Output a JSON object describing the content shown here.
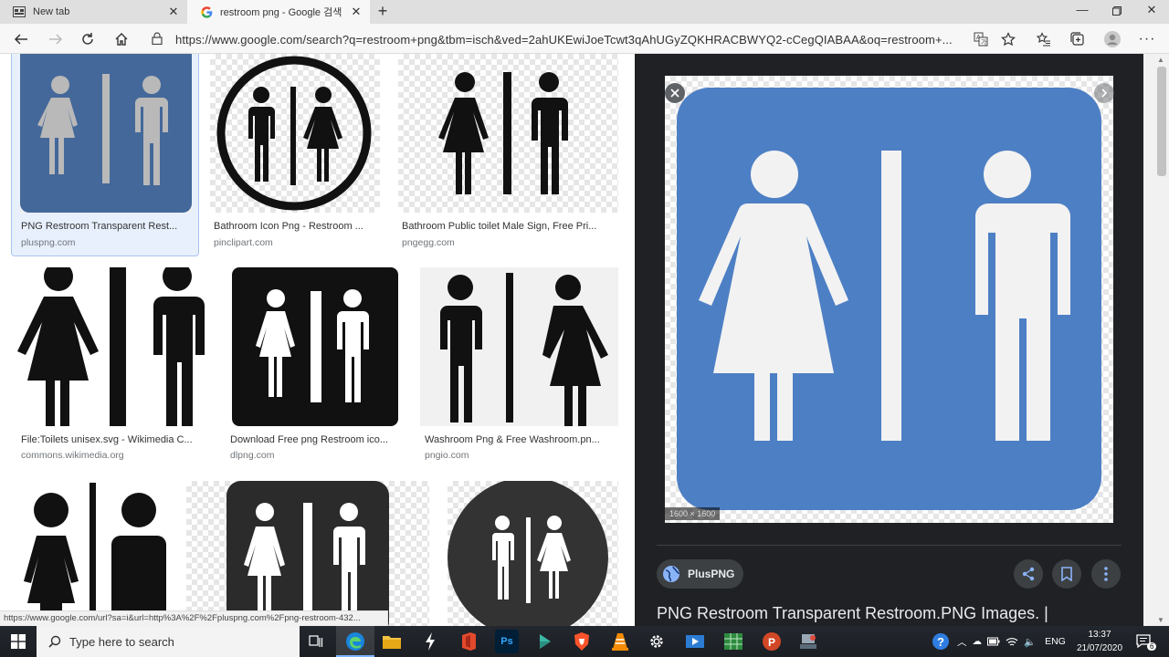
{
  "browser": {
    "tabs": [
      {
        "title": "New tab",
        "active": false
      },
      {
        "title": "restroom png - Google 검색",
        "active": true
      }
    ],
    "url": "https://www.google.com/search?q=restroom+png&tbm=isch&ved=2ahUKEwiJoeTcwt3qAhUGyZQKHRACBWYQ2-cCegQIABAA&oq=restroom+..."
  },
  "results": [
    {
      "title": "PNG Restroom Transparent Rest...",
      "source": "pluspng.com"
    },
    {
      "title": "Bathroom Icon Png - Restroom ...",
      "source": "pinclipart.com"
    },
    {
      "title": "Bathroom Public toilet Male Sign, Free Pri...",
      "source": "pngegg.com"
    },
    {
      "title": "File:Toilets unisex.svg - Wikimedia C...",
      "source": "commons.wikimedia.org"
    },
    {
      "title": "Download Free png Restroom ico...",
      "source": "dlpng.com"
    },
    {
      "title": "Washroom Png & Free Washroom.pn...",
      "source": "pngio.com"
    }
  ],
  "status_url": "https://www.google.com/url?sa=i&url=http%3A%2F%2Fpluspng.com%2Fpng-restroom-432...",
  "preview": {
    "dimensions": "1600 × 1600",
    "site": "PlusPNG",
    "title": "PNG Restroom Transparent Restroom.PNG Images. |"
  },
  "taskbar": {
    "search_placeholder": "Type here to search",
    "lang": "ENG",
    "time": "13:37",
    "date": "21/07/2020",
    "notifications": "6"
  },
  "colors": {
    "sign_blue": "#4d7fc4",
    "panel_bg": "#202124"
  }
}
